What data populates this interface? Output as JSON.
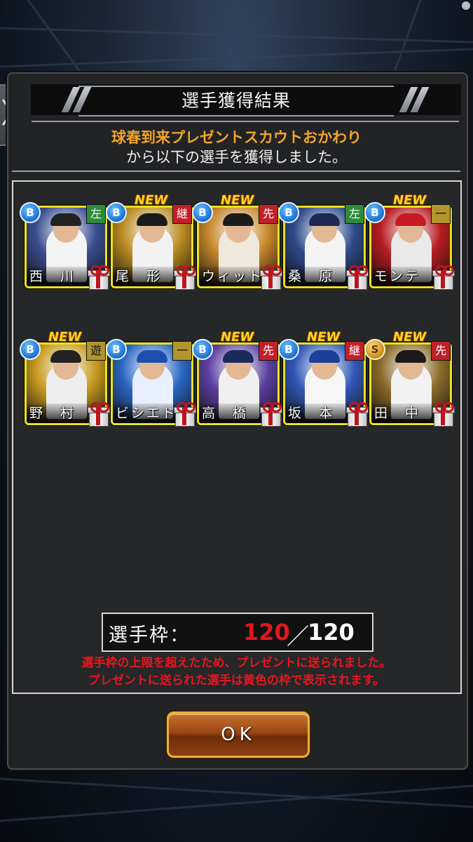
{
  "dialog": {
    "title": "選手獲得結果",
    "message_line1": "球春到来プレゼントスカウトおかわり",
    "message_line2": "から以下の選手を獲得しました。"
  },
  "players": [
    {
      "name": "西　川",
      "rank": "B",
      "position": "左",
      "position_color": "#2e8b3a",
      "new": "",
      "bg": "#3a4d8f",
      "uniform": "#f4f4f4",
      "cap": "#222"
    },
    {
      "name": "尾　形",
      "rank": "B",
      "position": "継",
      "position_color": "#c0202a",
      "new": "NEW",
      "bg": "#b88a20",
      "uniform": "#f2f2f2",
      "cap": "#1a1a1a"
    },
    {
      "name": "ウィット",
      "rank": "B",
      "position": "先",
      "position_color": "#c0202a",
      "new": "NEW",
      "bg": "#c6862a",
      "uniform": "#efe8dd",
      "cap": "#1b1b1b"
    },
    {
      "name": "桑　原",
      "rank": "B",
      "position": "左",
      "position_color": "#2e8b3a",
      "new": "",
      "bg": "#2d4a8a",
      "uniform": "#f4f4f4",
      "cap": "#1c2a55"
    },
    {
      "name": "モンテ",
      "rank": "B",
      "position": "一",
      "position_color": "#b2952c",
      "new": "NEW",
      "bg": "#b51c22",
      "uniform": "#e9e9e9",
      "cap": "#c81a22"
    },
    {
      "name": "野　村",
      "rank": "B",
      "position": "遊",
      "position_color": "#b2952c",
      "new": "NEW",
      "bg": "#c79a1e",
      "uniform": "#eeeeee",
      "cap": "#222"
    },
    {
      "name": "ビシエド",
      "rank": "B",
      "position": "一",
      "position_color": "#b2952c",
      "new": "",
      "bg": "#2a66c2",
      "uniform": "#e8f0ff",
      "cap": "#1e4fb0"
    },
    {
      "name": "高　橋",
      "rank": "B",
      "position": "先",
      "position_color": "#c0202a",
      "new": "NEW",
      "bg": "#5b3fa0",
      "uniform": "#f0f0f0",
      "cap": "#1a2a5a"
    },
    {
      "name": "坂　本",
      "rank": "B",
      "position": "継",
      "position_color": "#c0202a",
      "new": "NEW",
      "bg": "#3158b8",
      "uniform": "#f6f6f6",
      "cap": "#1d3f9c"
    },
    {
      "name": "田　中",
      "rank": "S",
      "position": "先",
      "position_color": "#c0202a",
      "new": "NEW",
      "bg": "#8a6a2a",
      "uniform": "#f2f2f2",
      "cap": "#1a1a1a"
    }
  ],
  "roster": {
    "label": "選手枠：",
    "current": "120",
    "separator": "／",
    "max": "120"
  },
  "warning": {
    "line1": "選手枠の上限を超えたため、プレゼントに送られました。",
    "line2": "プレゼントに送られた選手は黄色の枠で表示されます。"
  },
  "buttons": {
    "ok": "OK",
    "side_tab": "〉"
  }
}
